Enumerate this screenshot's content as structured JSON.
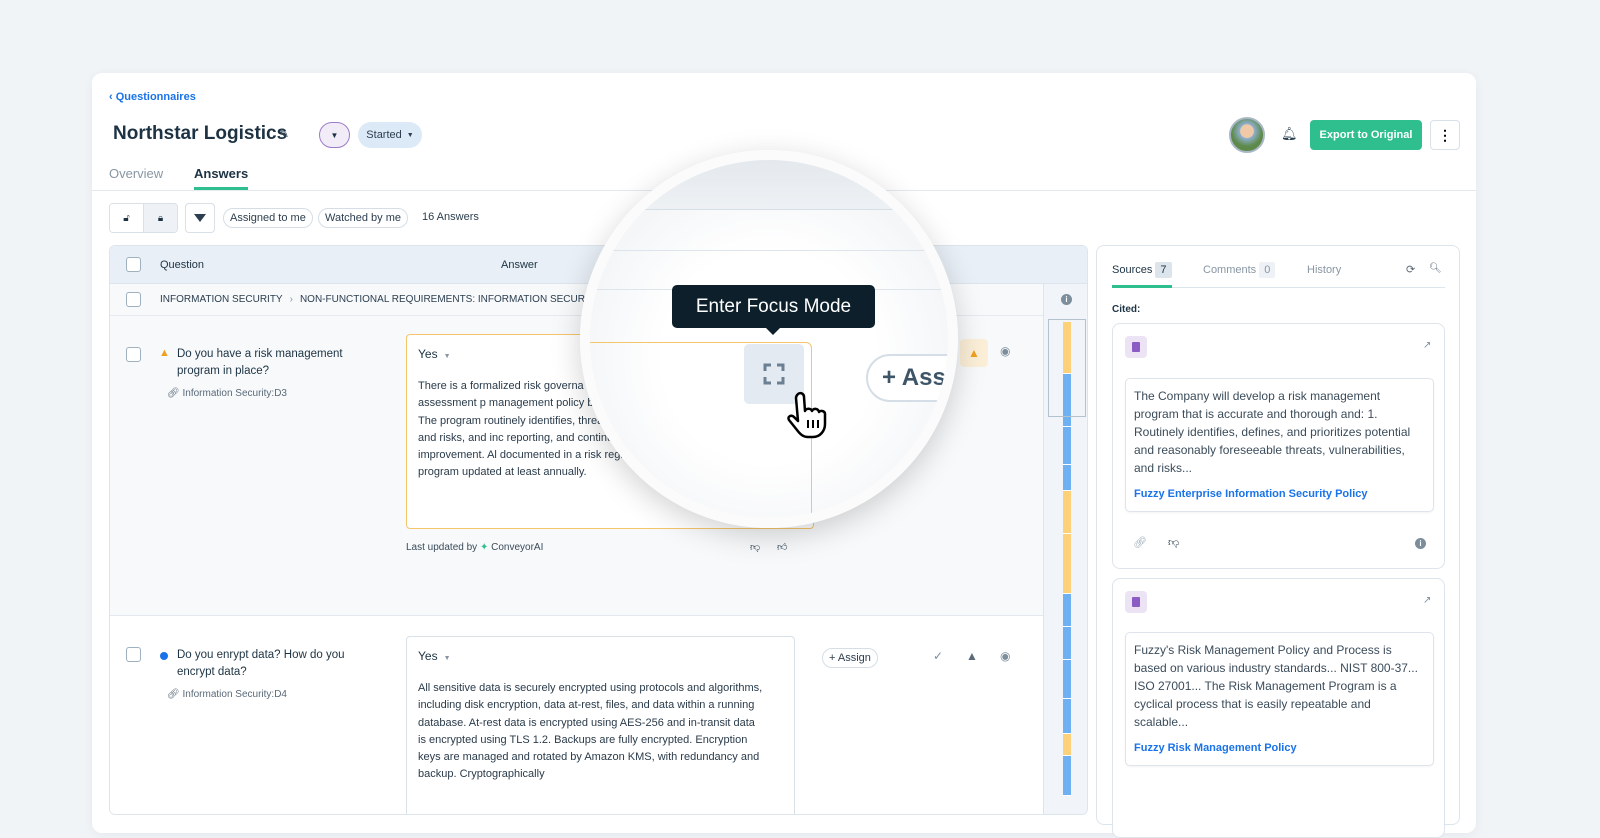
{
  "breadcrumb": {
    "back_label": "Questionnaires"
  },
  "header": {
    "title": "Northstar Logistics",
    "status": "Started",
    "export_label": "Export to Original"
  },
  "tabs": [
    {
      "label": "Overview"
    },
    {
      "label": "Answers"
    }
  ],
  "toolbar": {
    "chips": [
      "Assigned to me",
      "Watched by me"
    ],
    "count": "16 Answers"
  },
  "table": {
    "columns": {
      "question": "Question",
      "answer": "Answer"
    },
    "section": {
      "part1": "INFORMATION SECURITY",
      "part2": "NON-FUNCTIONAL REQUIREMENTS: INFORMATION SECUR"
    },
    "rows": [
      {
        "question": "Do you have a risk management program in place?",
        "ref": "Information Security:D3",
        "answer_value": "Yes",
        "answer_text": "There is a formalized risk governa management, a risk assessment p management policy based on indus ISO. The program routinely identifies, threats, vulnerabilities, and risks, and inc reporting, and continuous improvement. Al documented in a risk register, and the program updated at least annually.",
        "updated_prefix": "Last updated by",
        "updated_by": "ConveyorAI"
      },
      {
        "question": "Do you enrypt data? How do you encrypt data?",
        "ref": "Information Security:D4",
        "answer_value": "Yes",
        "answer_text": "All sensitive data is securely encrypted using protocols and algorithms, including disk encryption, data at-rest, files, and data within a running database. At-rest data is encrypted using AES-256 and in-transit data is encrypted using TLS 1.2. Backups are fully encrypted. Encryption keys are managed and rotated by Amazon KMS, with redundancy and backup. Cryptographically",
        "assign_label": "+ Assign"
      }
    ]
  },
  "minimap": {
    "statuses": [
      "warning",
      "complete",
      "complete",
      "complete",
      "warning",
      "warning",
      "complete",
      "complete",
      "complete",
      "complete",
      "warning",
      "complete"
    ],
    "colors": {
      "warning": "#fcd17a",
      "complete": "#6fb0f2"
    }
  },
  "magnifier": {
    "tooltip": "Enter Focus Mode",
    "assign_label": "+ Assign",
    "section_fragment": "UR"
  },
  "panel": {
    "tabs": [
      {
        "label": "Sources",
        "count": "7"
      },
      {
        "label": "Comments",
        "count": "0"
      },
      {
        "label": "History"
      }
    ],
    "cited_label": "Cited:",
    "sources": [
      {
        "text": "The Company will develop a risk management program that is accurate and thorough and: 1. Routinely identifies, defines, and prioritizes potential and reasonably foreseeable threats, vulnerabilities, and risks...",
        "title": "Fuzzy Enterprise Information Security Policy"
      },
      {
        "text": "Fuzzy's Risk Management Policy and Process is based on various industry standards... NIST 800-37... ISO 27001... The Risk Management Program is a cyclical process that is easily repeatable and scalable...",
        "title": "Fuzzy Risk Management Policy"
      }
    ]
  },
  "colors": {
    "accent": "#2fbf8f",
    "link": "#1a73e8",
    "warning": "#f0a020",
    "tooltip_bg": "#0c1f2a"
  }
}
